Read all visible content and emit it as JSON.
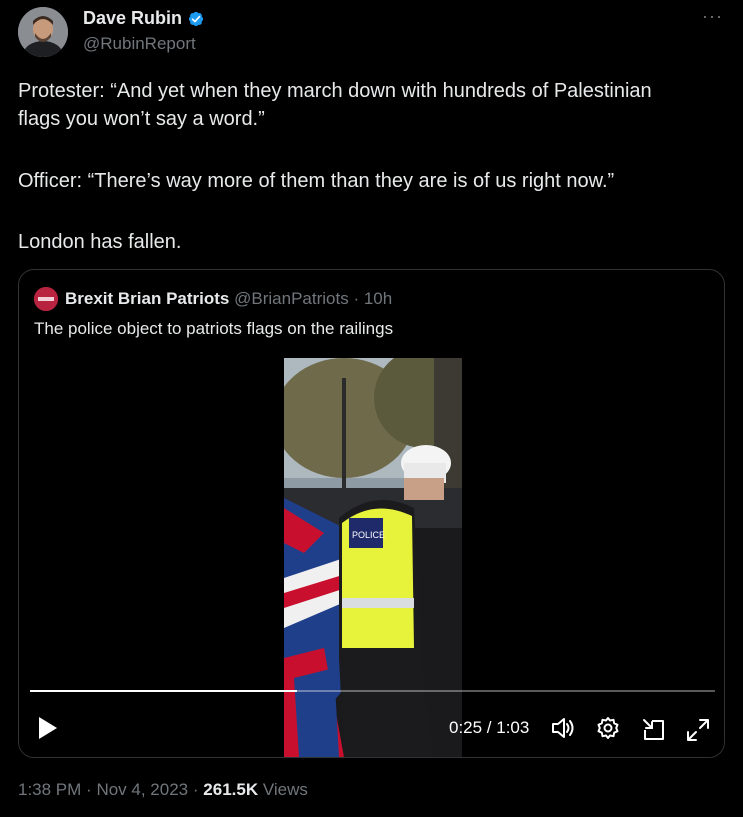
{
  "author": {
    "name": "Dave Rubin",
    "handle": "@RubinReport",
    "verified_color": "#1d9bf0"
  },
  "more_label": "···",
  "tweet": {
    "lines": [
      "Protester: “And yet when they march down with hundreds of Palestinian",
      "flags you won’t say a word.”",
      "Officer: “There’s way more of them than they are is of us right now.”",
      "London has fallen."
    ]
  },
  "quote": {
    "name": "Brexit Brian Patriots",
    "handle": "@BrianPatriots",
    "separator": "·",
    "age": "10h",
    "text": "The police object to patriots flags on the railings"
  },
  "video": {
    "progress": 0.39,
    "time_label": "0:25 / 1:03",
    "controls": [
      "play-icon",
      "volume-icon",
      "settings-icon",
      "pip-icon",
      "fullscreen-icon"
    ]
  },
  "footer": {
    "time": "1:38 PM",
    "sep1": "·",
    "date": "Nov 4, 2023",
    "sep2": "·",
    "views_count": "261.5K",
    "views_label": "Views"
  }
}
